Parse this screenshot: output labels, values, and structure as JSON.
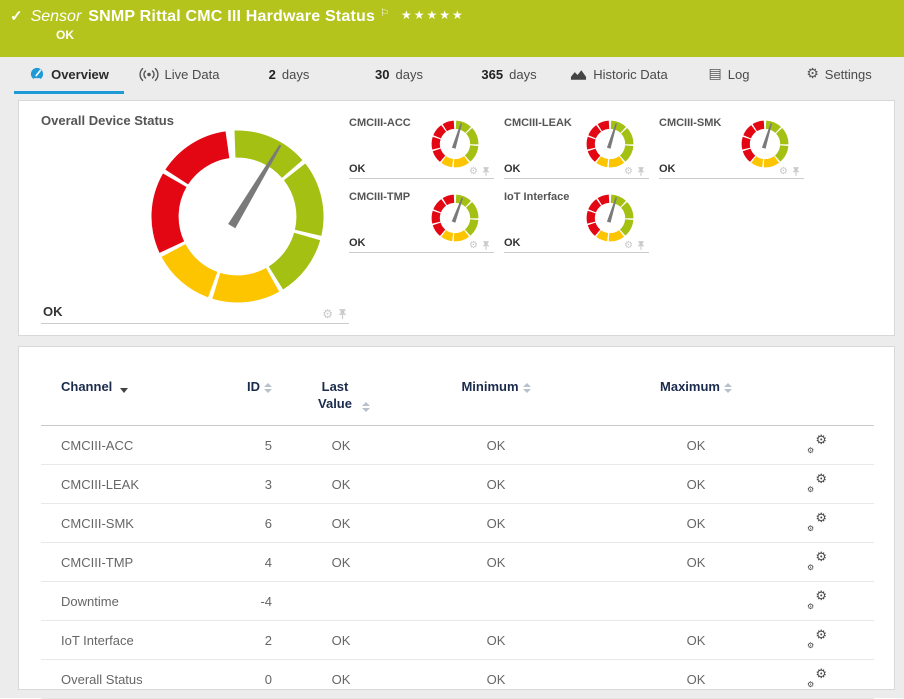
{
  "colors": {
    "green": "#a3c013",
    "yellow": "#fdc400",
    "red": "#e30613",
    "needle": "#7a7a7a",
    "accent_blue": "#1e9ad6",
    "header_bg": "#b4c41c"
  },
  "header": {
    "check_icon": "✓",
    "kind": "Sensor",
    "title": "SNMP Rittal CMC III Hardware Status",
    "flag_icon": "⚐",
    "stars": "★★★★★",
    "status": "OK"
  },
  "tabs": {
    "overview": {
      "label": "Overview",
      "icon": "gauge-icon",
      "active": true
    },
    "live_data": {
      "label": "Live Data",
      "icon": "broadcast-icon"
    },
    "days2": {
      "num": "2",
      "label": "days"
    },
    "days30": {
      "num": "30",
      "label": "days"
    },
    "days365": {
      "num": "365",
      "label": "days"
    },
    "historic": {
      "label": "Historic Data",
      "icon": "area-chart-icon"
    },
    "log": {
      "label": "Log",
      "icon": "list-icon"
    },
    "settings": {
      "label": "Settings",
      "icon": "gear-icon"
    }
  },
  "gauges": {
    "big": {
      "title": "Overall Device Status",
      "status": "OK",
      "needle_deg": 31
    },
    "mini": [
      {
        "title": "CMCIII-ACC",
        "status": "OK",
        "needle_deg": 17
      },
      {
        "title": "CMCIII-LEAK",
        "status": "OK",
        "needle_deg": 17
      },
      {
        "title": "CMCIII-SMK",
        "status": "OK",
        "needle_deg": 17
      },
      {
        "title": "CMCIII-TMP",
        "status": "OK",
        "needle_deg": 20
      },
      {
        "title": "IoT Interface",
        "status": "OK",
        "needle_deg": 17
      }
    ]
  },
  "table": {
    "columns": {
      "channel": "Channel",
      "id": "ID",
      "last_value": "Last Value",
      "minimum": "Minimum",
      "maximum": "Maximum"
    },
    "rows": [
      {
        "channel": "CMCIII-ACC",
        "id": "5",
        "last_value": "OK",
        "minimum": "OK",
        "maximum": "OK"
      },
      {
        "channel": "CMCIII-LEAK",
        "id": "3",
        "last_value": "OK",
        "minimum": "OK",
        "maximum": "OK"
      },
      {
        "channel": "CMCIII-SMK",
        "id": "6",
        "last_value": "OK",
        "minimum": "OK",
        "maximum": "OK"
      },
      {
        "channel": "CMCIII-TMP",
        "id": "4",
        "last_value": "OK",
        "minimum": "OK",
        "maximum": "OK"
      },
      {
        "channel": "Downtime",
        "id": "-4",
        "last_value": "",
        "minimum": "",
        "maximum": ""
      },
      {
        "channel": "IoT Interface",
        "id": "2",
        "last_value": "OK",
        "minimum": "OK",
        "maximum": "OK"
      },
      {
        "channel": "Overall Status",
        "id": "0",
        "last_value": "OK",
        "minimum": "OK",
        "maximum": "OK"
      }
    ]
  }
}
